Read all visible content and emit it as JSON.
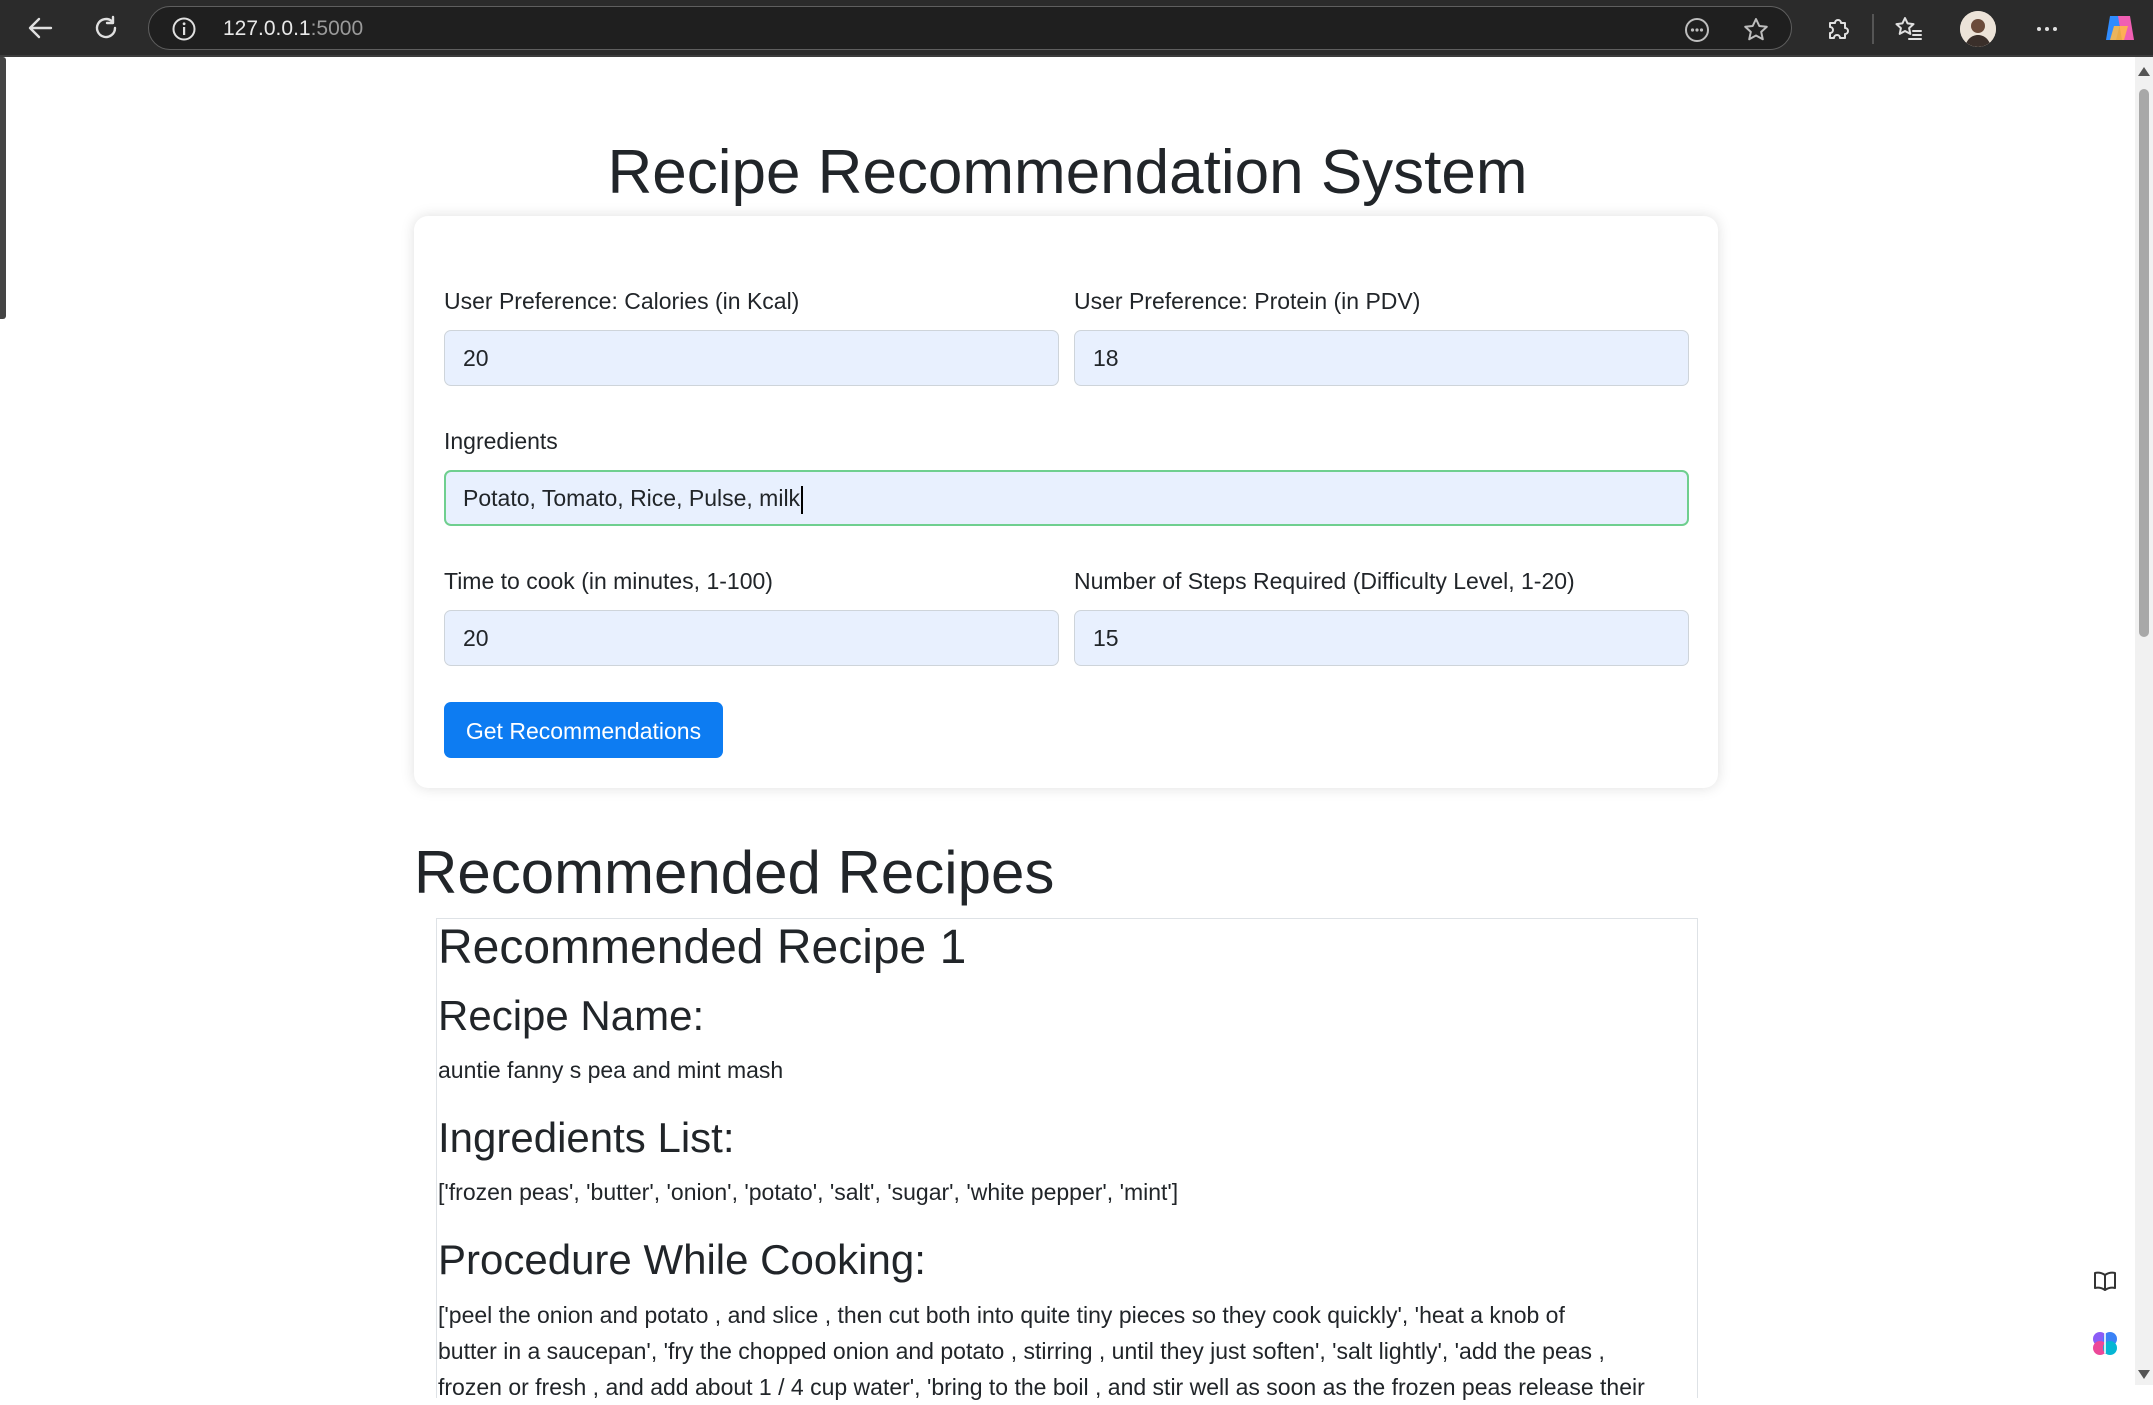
{
  "browser": {
    "url_host": "127.0.0.1",
    "url_port": ":5000"
  },
  "page": {
    "title": "Recipe Recommendation System"
  },
  "form": {
    "calories": {
      "label": "User Preference: Calories (in Kcal)",
      "value": "20"
    },
    "protein": {
      "label": "User Preference: Protein (in PDV)",
      "value": "18"
    },
    "ingredients": {
      "label": "Ingredients",
      "value": "Potato, Tomato, Rice, Pulse, milk"
    },
    "time": {
      "label": "Time to cook (in minutes, 1-100)",
      "value": "20"
    },
    "steps": {
      "label": "Number of Steps Required (Difficulty Level, 1-20)",
      "value": "15"
    },
    "submit_label": "Get Recommendations"
  },
  "results": {
    "heading": "Recommended Recipes",
    "recipes": [
      {
        "heading": "Recommended Recipe 1",
        "name_label": "Recipe Name:",
        "name": "auntie fanny s pea and mint mash",
        "ingredients_label": "Ingredients List:",
        "ingredients": "['frozen peas', 'butter', 'onion', 'potato', 'salt', 'sugar', 'white pepper', 'mint']",
        "procedure_label": "Procedure While Cooking:",
        "procedure_line1": "['peel the onion and potato , and slice , then cut both into quite tiny pieces so they cook quickly', 'heat a knob of",
        "procedure_line2": "butter in a saucepan', 'fry the chopped onion and potato , stirring , until they just soften', 'salt lightly', 'add the peas ,",
        "procedure_line3": "frozen or fresh , and add about 1 / 4 cup water', 'bring to the boil , and stir well as soon as the frozen peas release their"
      }
    ]
  }
}
